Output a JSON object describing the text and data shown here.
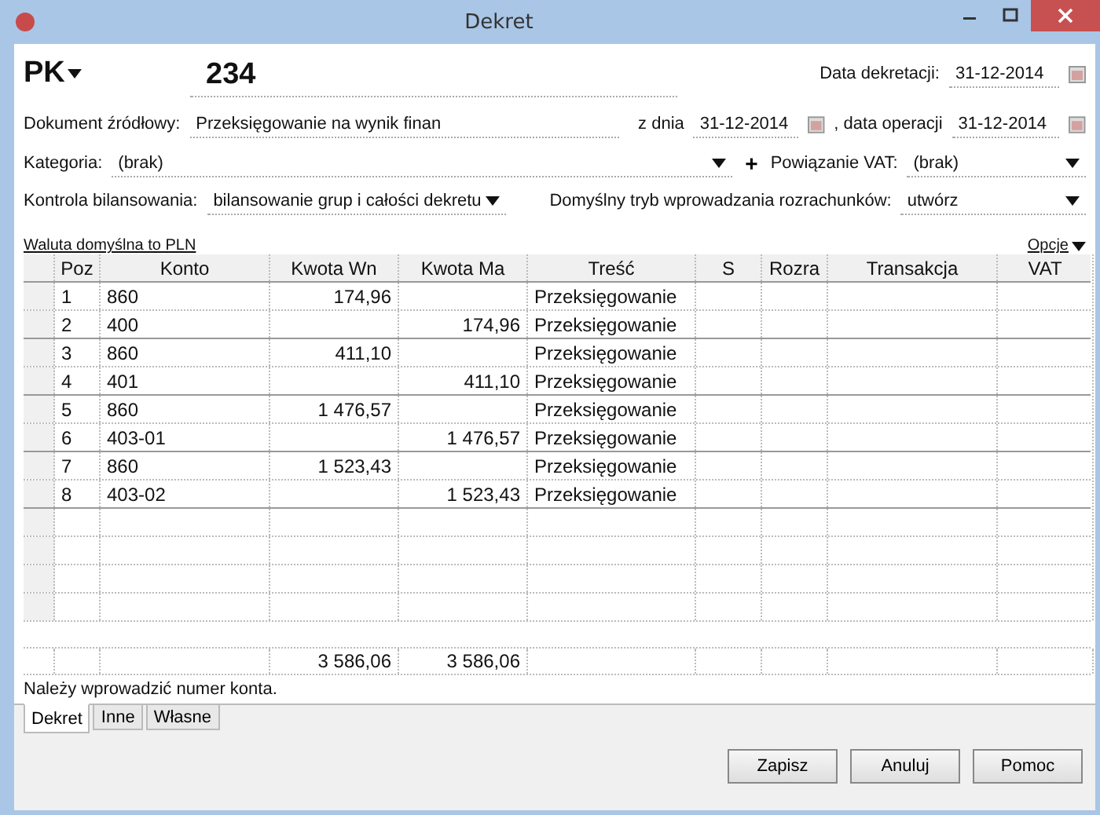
{
  "window": {
    "title": "Dekret"
  },
  "document": {
    "type": "PK",
    "number": "234"
  },
  "posting_date": {
    "label": "Data dekretacji:",
    "value": "31-12-2014"
  },
  "source_document": {
    "label": "Dokument źródłowy:",
    "value": "Przeksięgowanie na wynik finan"
  },
  "source_date": {
    "label": "z dnia",
    "value": "31-12-2014"
  },
  "operation_date": {
    "label": ", data operacji",
    "value": "31-12-2014"
  },
  "category": {
    "label": "Kategoria:",
    "value": "(brak)",
    "add": "+"
  },
  "vat_link": {
    "label": "Powiązanie VAT:",
    "value": "(brak)"
  },
  "balance_control": {
    "label": "Kontrola bilansowania:",
    "value": "bilansowanie grup i całości dekretu"
  },
  "settlement_mode": {
    "label": "Domyślny tryb wprowadzania rozrachunków:",
    "value": "utwórz"
  },
  "currency_link": "Waluta domyślna to PLN",
  "options_link": "Opcje",
  "table": {
    "columns": [
      "Poz",
      "Konto",
      "Kwota Wn",
      "Kwota Ma",
      "Treść",
      "S",
      "Rozra",
      "Transakcja",
      "VAT"
    ],
    "rows": [
      {
        "poz": "1",
        "konto": "860",
        "wn": "174,96",
        "tresc": "Przeksięgowanie"
      },
      {
        "poz": "2",
        "konto": "400",
        "ma": "174,96",
        "tresc": "Przeksięgowanie"
      },
      {
        "poz": "3",
        "konto": "860",
        "wn": "411,10",
        "tresc": "Przeksięgowanie"
      },
      {
        "poz": "4",
        "konto": "401",
        "ma": "411,10",
        "tresc": "Przeksięgowanie"
      },
      {
        "poz": "5",
        "konto": "860",
        "wn": "1 476,57",
        "tresc": "Przeksięgowanie"
      },
      {
        "poz": "6",
        "konto": "403-01",
        "ma": "1 476,57",
        "tresc": "Przeksięgowanie"
      },
      {
        "poz": "7",
        "konto": "860",
        "wn": "1 523,43",
        "tresc": "Przeksięgowanie"
      },
      {
        "poz": "8",
        "konto": "403-02",
        "ma": "1 523,43",
        "tresc": "Przeksięgowanie"
      }
    ],
    "totals": {
      "wn": "3 586,06",
      "ma": "3 586,06"
    }
  },
  "message": "Należy wprowadzić numer konta.",
  "tabs": [
    {
      "label": "Dekret",
      "selected": true
    },
    {
      "label": "Inne",
      "selected": false
    },
    {
      "label": "Własne",
      "selected": false
    }
  ],
  "buttons": [
    "Zapisz",
    "Anuluj",
    "Pomoc"
  ]
}
